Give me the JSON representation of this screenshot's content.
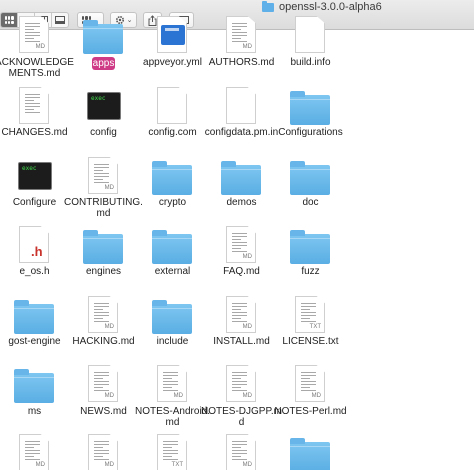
{
  "window": {
    "title": "openssl-3.0.0-alpha6"
  },
  "toolbar": {
    "view_icon": "icon-view-button",
    "list_icon": "list-view-button",
    "column_icon": "column-view-button",
    "gallery_icon": "gallery-view-button",
    "group_icon": "group-by-button",
    "action_icon": "gear-icon",
    "share_icon": "share-icon",
    "tag_icon": "tag-icon",
    "caret": "⌄"
  },
  "files": [
    {
      "name": "ACKNOWLEDGEMENTS.md",
      "kind": "doc",
      "tag": "MD"
    },
    {
      "name": "apps",
      "kind": "folder",
      "selected": true
    },
    {
      "name": "appveyor.yml",
      "kind": "bluedoc"
    },
    {
      "name": "AUTHORS.md",
      "kind": "doc",
      "tag": "MD"
    },
    {
      "name": "build.info",
      "kind": "blank"
    },
    {
      "name": "CHANGES.md",
      "kind": "doc"
    },
    {
      "name": "config",
      "kind": "exec",
      "exec_label": "exec"
    },
    {
      "name": "config.com",
      "kind": "blank"
    },
    {
      "name": "configdata.pm.in",
      "kind": "blank"
    },
    {
      "name": "Configurations",
      "kind": "folder"
    },
    {
      "name": "Configure",
      "kind": "exec",
      "exec_label": "exec"
    },
    {
      "name": "CONTRIBUTING.md",
      "kind": "doc",
      "tag": "MD"
    },
    {
      "name": "crypto",
      "kind": "folder"
    },
    {
      "name": "demos",
      "kind": "folder"
    },
    {
      "name": "doc",
      "kind": "folder"
    },
    {
      "name": "e_os.h",
      "kind": "hfile",
      "glyph": ".h"
    },
    {
      "name": "engines",
      "kind": "folder"
    },
    {
      "name": "external",
      "kind": "folder"
    },
    {
      "name": "FAQ.md",
      "kind": "doc",
      "tag": "MD"
    },
    {
      "name": "fuzz",
      "kind": "folder"
    },
    {
      "name": "gost-engine",
      "kind": "folder"
    },
    {
      "name": "HACKING.md",
      "kind": "doc",
      "tag": "MD"
    },
    {
      "name": "include",
      "kind": "folder"
    },
    {
      "name": "INSTALL.md",
      "kind": "doc",
      "tag": "MD"
    },
    {
      "name": "LICENSE.txt",
      "kind": "doc",
      "tag": "TXT"
    },
    {
      "name": "ms",
      "kind": "folder"
    },
    {
      "name": "NEWS.md",
      "kind": "doc",
      "tag": "MD"
    },
    {
      "name": "NOTES-Android.md",
      "kind": "doc",
      "tag": "MD"
    },
    {
      "name": "NOTES-DJGPP.md",
      "kind": "doc",
      "tag": "MD"
    },
    {
      "name": "NOTES-Perl.md",
      "kind": "doc",
      "tag": "MD"
    },
    {
      "name": "",
      "kind": "doc",
      "tag": "MD"
    },
    {
      "name": "",
      "kind": "doc",
      "tag": "MD"
    },
    {
      "name": "",
      "kind": "doc",
      "tag": "TXT"
    },
    {
      "name": "",
      "kind": "doc",
      "tag": "MD"
    },
    {
      "name": "",
      "kind": "folder"
    }
  ],
  "colors": {
    "selection": "#cf3a86",
    "folder": "#5aaee3"
  }
}
